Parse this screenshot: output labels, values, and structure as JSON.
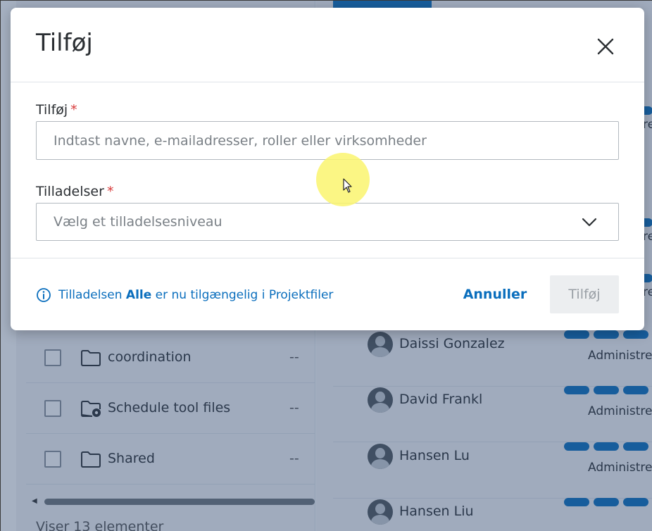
{
  "dialog": {
    "title": "Tilføj",
    "close_icon": "close-icon",
    "add_field": {
      "label": "Tilføj",
      "required_mark": "*",
      "placeholder": "Indtast navne, e-mailadresser, roller eller virksomheder",
      "value": ""
    },
    "permissions_field": {
      "label": "Tilladelser",
      "required_mark": "*",
      "placeholder": "Vælg et tilladelsesniveau",
      "icon": "chevron-down-icon"
    },
    "info": {
      "icon": "info-icon",
      "prefix": "Tilladelsen ",
      "highlight": "Alle",
      "suffix": " er nu tilgængelig i Projektfiler"
    },
    "cancel_label": "Annuller",
    "submit_label": "Tilføj",
    "submit_disabled": true
  },
  "background": {
    "folders": [
      {
        "name": "coordination",
        "size": "--",
        "icon": "folder-icon"
      },
      {
        "name": "Schedule tool files",
        "size": "--",
        "icon": "folder-gear-icon"
      },
      {
        "name": "Shared",
        "size": "--",
        "icon": "folder-icon"
      }
    ],
    "footer_count": "Viser 13 elementer",
    "members": [
      {
        "name": "Daissi Gonzalez",
        "role": "Administre"
      },
      {
        "name": "David Frankl",
        "role": "Administre"
      },
      {
        "name": "Hansen Lu",
        "role": "Administre"
      },
      {
        "name": "Hansen Liu",
        "role": ""
      }
    ],
    "peek_texts": [
      "re",
      "re",
      "re"
    ]
  },
  "colors": {
    "accent": "#0a6ebd",
    "required": "#d83b3b",
    "overlay": "#2a466e",
    "cursor_highlight": "#faf56e"
  }
}
